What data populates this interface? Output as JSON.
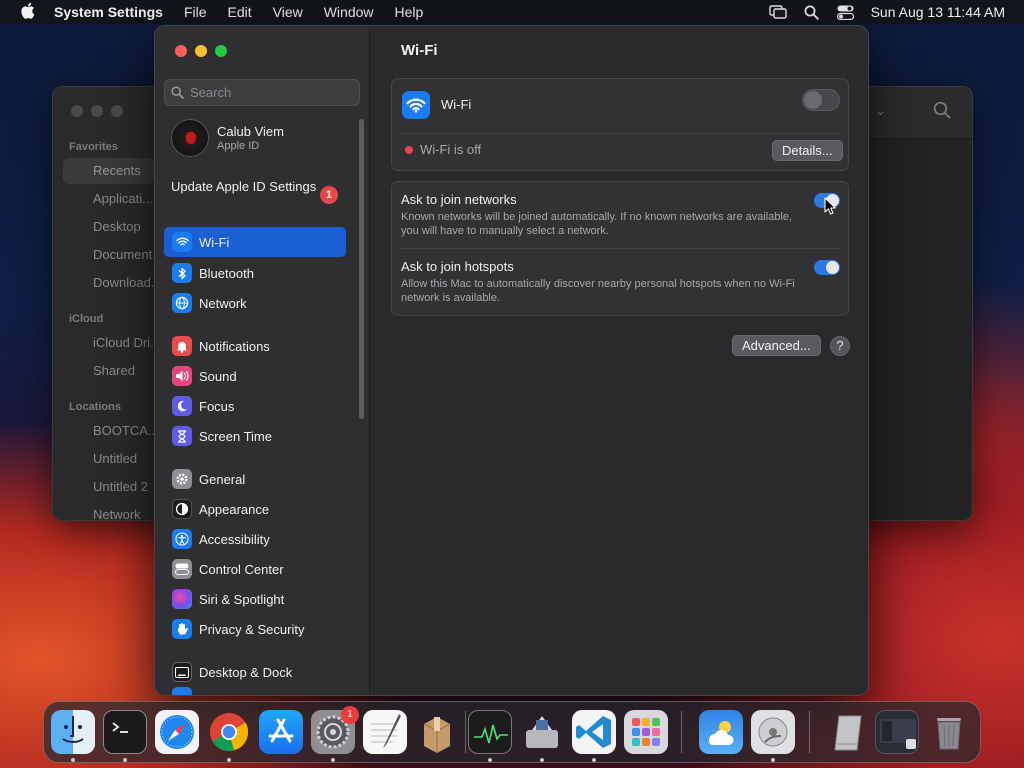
{
  "menubar": {
    "app_name": "System Settings",
    "menus": [
      "File",
      "Edit",
      "View",
      "Window",
      "Help"
    ],
    "clock": "Sun Aug 13  11:44 AM"
  },
  "finder": {
    "favorites_head": "Favorites",
    "favorites": [
      "Recents",
      "Applicati...",
      "Desktop",
      "Document...",
      "Download..."
    ],
    "icloud_head": "iCloud",
    "icloud": [
      "iCloud Dri...",
      "Shared"
    ],
    "locations_head": "Locations",
    "locations": [
      "BOOTCA...",
      "Untitled",
      "Untitled 2",
      "Network"
    ]
  },
  "sidebar": {
    "search_placeholder": "Search",
    "user_name": "Calub Viem",
    "user_sub": "Apple ID",
    "update_label": "Update Apple ID Settings",
    "update_badge": "1",
    "items": [
      {
        "label": "Wi-Fi",
        "icon": "wifi-icon",
        "color": "#1b7cf2"
      },
      {
        "label": "Bluetooth",
        "icon": "bluetooth-icon",
        "color": "#1b7cf2"
      },
      {
        "label": "Network",
        "icon": "globe-icon",
        "color": "#1b7cf2"
      },
      {
        "label": "Notifications",
        "icon": "bell-icon",
        "color": "#ea4a4a"
      },
      {
        "label": "Sound",
        "icon": "speaker-icon",
        "color": "#e8457a"
      },
      {
        "label": "Focus",
        "icon": "moon-icon",
        "color": "#5e5ce6"
      },
      {
        "label": "Screen Time",
        "icon": "hourglass-icon",
        "color": "#5e5ce6"
      },
      {
        "label": "General",
        "icon": "gear-icon",
        "color": "#8e8e93"
      },
      {
        "label": "Appearance",
        "icon": "appearance-icon",
        "color": "#1c1c1e"
      },
      {
        "label": "Accessibility",
        "icon": "accessibility-icon",
        "color": "#1b7cf2"
      },
      {
        "label": "Control Center",
        "icon": "control-center-icon",
        "color": "#8e8e93"
      },
      {
        "label": "Siri & Spotlight",
        "icon": "siri-icon",
        "color": "#b04ec8"
      },
      {
        "label": "Privacy & Security",
        "icon": "hand-icon",
        "color": "#1b7cf2"
      },
      {
        "label": "Desktop & Dock",
        "icon": "desktop-icon",
        "color": "#1c1c1e"
      }
    ]
  },
  "wifi": {
    "title": "Wi-Fi",
    "toggle_label": "Wi-Fi",
    "status": "Wi-Fi is off",
    "details_button": "Details...",
    "ask_networks_title": "Ask to join networks",
    "ask_networks_desc": "Known networks will be joined automatically. If no known networks are available, you will have to manually select a network.",
    "ask_hotspots_title": "Ask to join hotspots",
    "ask_hotspots_desc": "Allow this Mac to automatically discover nearby personal hotspots when no Wi-Fi network is available.",
    "advanced_button": "Advanced...",
    "help_button": "?"
  },
  "dock": {
    "apps": [
      "finder",
      "terminal",
      "safari",
      "chrome",
      "app-store",
      "system-settings",
      "textedit",
      "archive-utility",
      "activity-monitor",
      "boot-camp",
      "vscode",
      "launchpad",
      "weather",
      "disk-utility",
      "external-drive",
      "screenshot",
      "trash"
    ],
    "settings_badge": "1"
  },
  "colors": {
    "accent": "#1a5fd4",
    "toggle_on": "#2c79e4",
    "status_off": "#eb4545"
  }
}
